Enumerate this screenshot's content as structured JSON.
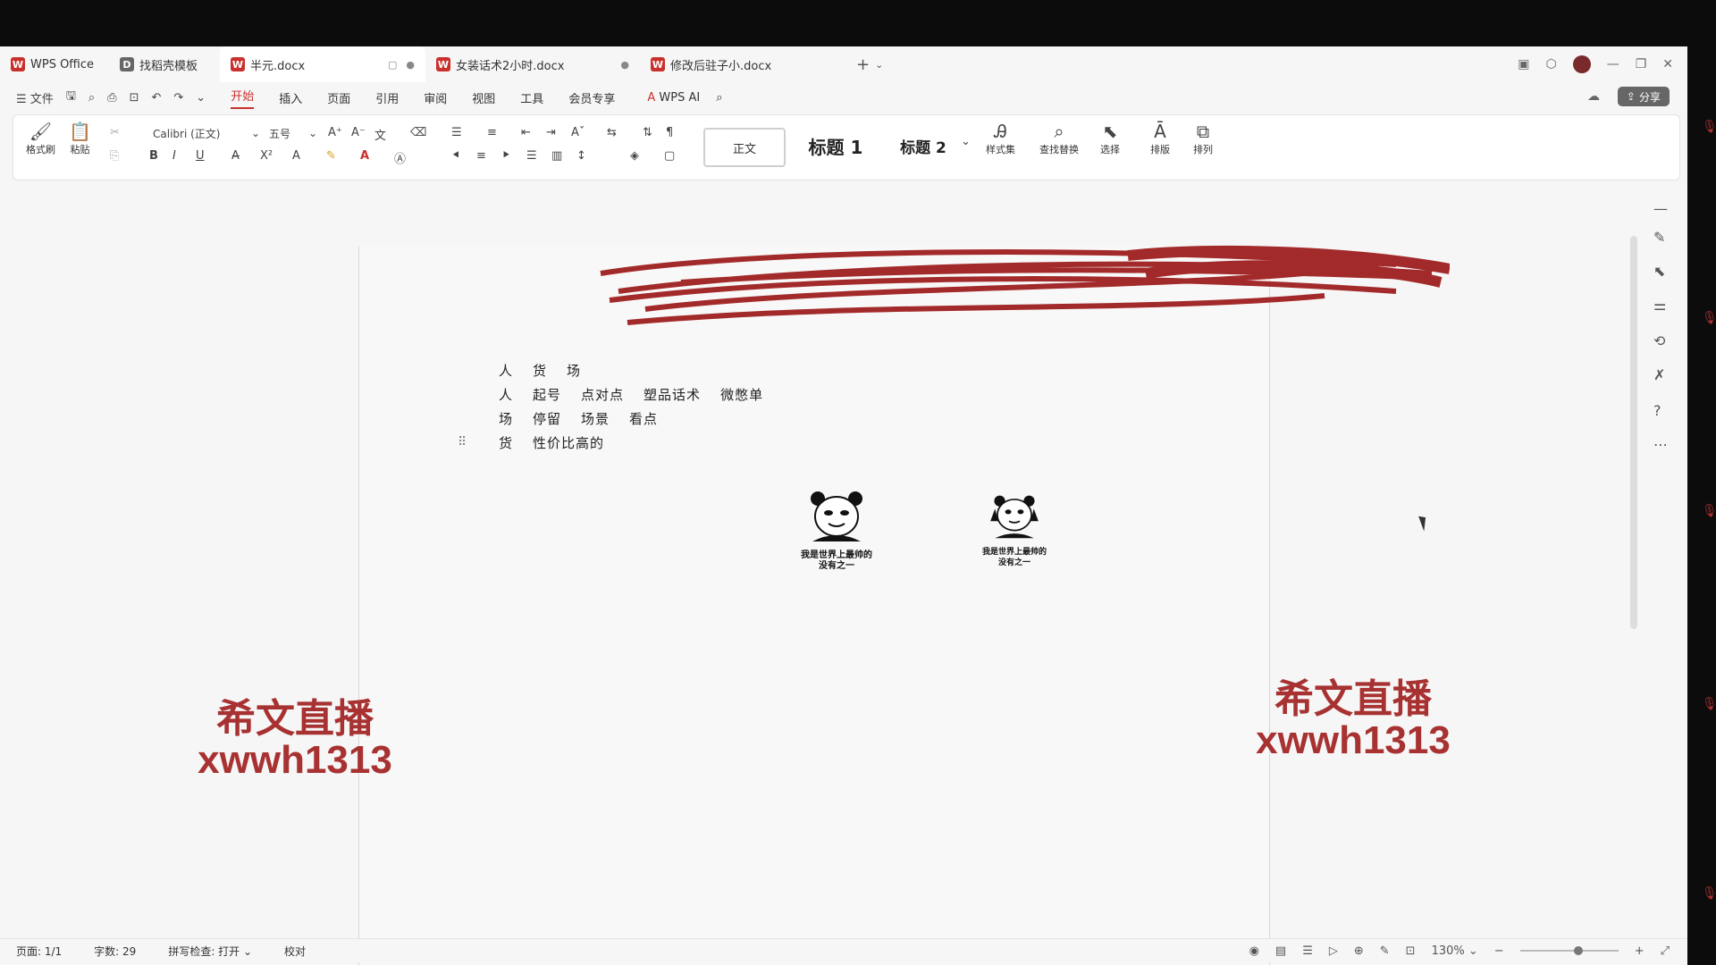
{
  "tabs": [
    {
      "name": "WPS Office",
      "logo_color": "#c9302c",
      "logo": "W"
    },
    {
      "name": "找稻壳模板",
      "logo_color": "#666",
      "logo": "D"
    },
    {
      "name": "半元.docx",
      "logo_color": "#c9302c",
      "logo": "W",
      "active": true
    },
    {
      "name": "女装话术2小时.docx",
      "logo_color": "#c9302c",
      "logo": "W"
    },
    {
      "name": "修改后驻子小.docx",
      "logo_color": "#c9302c",
      "logo": "W"
    }
  ],
  "menu": {
    "file": "文件",
    "items": [
      "开始",
      "插入",
      "页面",
      "引用",
      "审阅",
      "视图",
      "工具",
      "会员专享"
    ],
    "wps_ai": "WPS AI",
    "share": "分享"
  },
  "ribbon": {
    "format_brush": "格式刷",
    "paste": "粘贴",
    "font_name": "Calibri (正文)",
    "font_size": "五号",
    "style_normal": "正文",
    "style_h1": "标题 1",
    "style_h2": "标题 2",
    "style_set": "样式集",
    "find_replace": "查找替换",
    "select": "选择",
    "layout": "排版",
    "arrange": "排列"
  },
  "document": {
    "lines": [
      [
        "人",
        "货",
        "场"
      ],
      [
        "人",
        "起号",
        "点对点",
        "塑品话术",
        "微憋单"
      ],
      [
        "场",
        "停留",
        "场景",
        "看点"
      ],
      [
        "货",
        "性价比高的"
      ]
    ],
    "meme_caption_1": "我是世界上最帅的\n没有之一",
    "meme_caption_2": "我是世界上最帅的\n没有之一"
  },
  "watermark": {
    "title": "希文直播",
    "code": "xwwh1313"
  },
  "status": {
    "page": "页面: 1/1",
    "words": "字数: 29",
    "spell": "拼写检查: 打开",
    "proof": "校对",
    "zoom": "130%"
  },
  "colors": {
    "accent": "#c9302c",
    "watermark": "#a83232"
  }
}
